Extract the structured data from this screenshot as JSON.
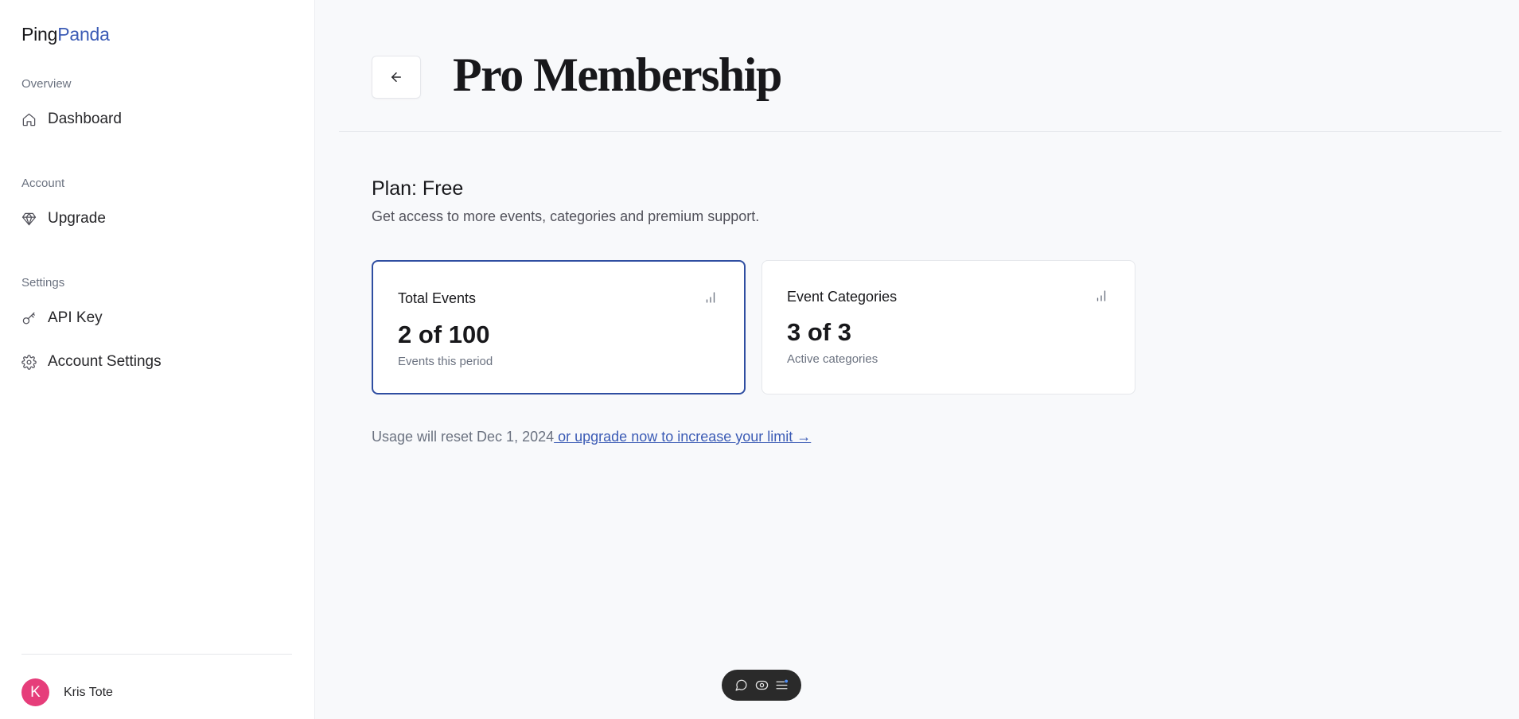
{
  "sidebar": {
    "logo": {
      "part1": "Ping",
      "part2": "Panda"
    },
    "sections": {
      "overview": {
        "label": "Overview",
        "items": [
          {
            "label": "Dashboard",
            "icon": "home-icon"
          }
        ]
      },
      "account": {
        "label": "Account",
        "items": [
          {
            "label": "Upgrade",
            "icon": "gem-icon"
          }
        ]
      },
      "settings": {
        "label": "Settings",
        "items": [
          {
            "label": "API Key",
            "icon": "key-icon"
          },
          {
            "label": "Account Settings",
            "icon": "gear-icon"
          }
        ]
      }
    },
    "user": {
      "initial": "K",
      "name": "Kris Tote",
      "avatar_color": "#e63d7a"
    }
  },
  "header": {
    "back_icon": "arrow-left-icon",
    "title": "Pro Membership"
  },
  "plan": {
    "title": "Plan: Free",
    "description": "Get access to more events, categories and premium support."
  },
  "cards": [
    {
      "title": "Total Events",
      "value": "2 of 100",
      "subtitle": "Events this period",
      "icon": "bar-chart-icon",
      "active": true
    },
    {
      "title": "Event Categories",
      "value": "3 of 3",
      "subtitle": "Active categories",
      "icon": "bar-chart-icon",
      "active": false
    }
  ],
  "usage": {
    "text": "Usage will reset Dec 1, 2024",
    "link": " or upgrade now to increase your limit →"
  },
  "toolbar": {
    "icons": [
      "comment-icon",
      "eye-icon",
      "menu-icon"
    ]
  },
  "colors": {
    "accent": "#3b5bb5",
    "active_border": "#2f4ea1",
    "background": "#f8f9fb"
  }
}
